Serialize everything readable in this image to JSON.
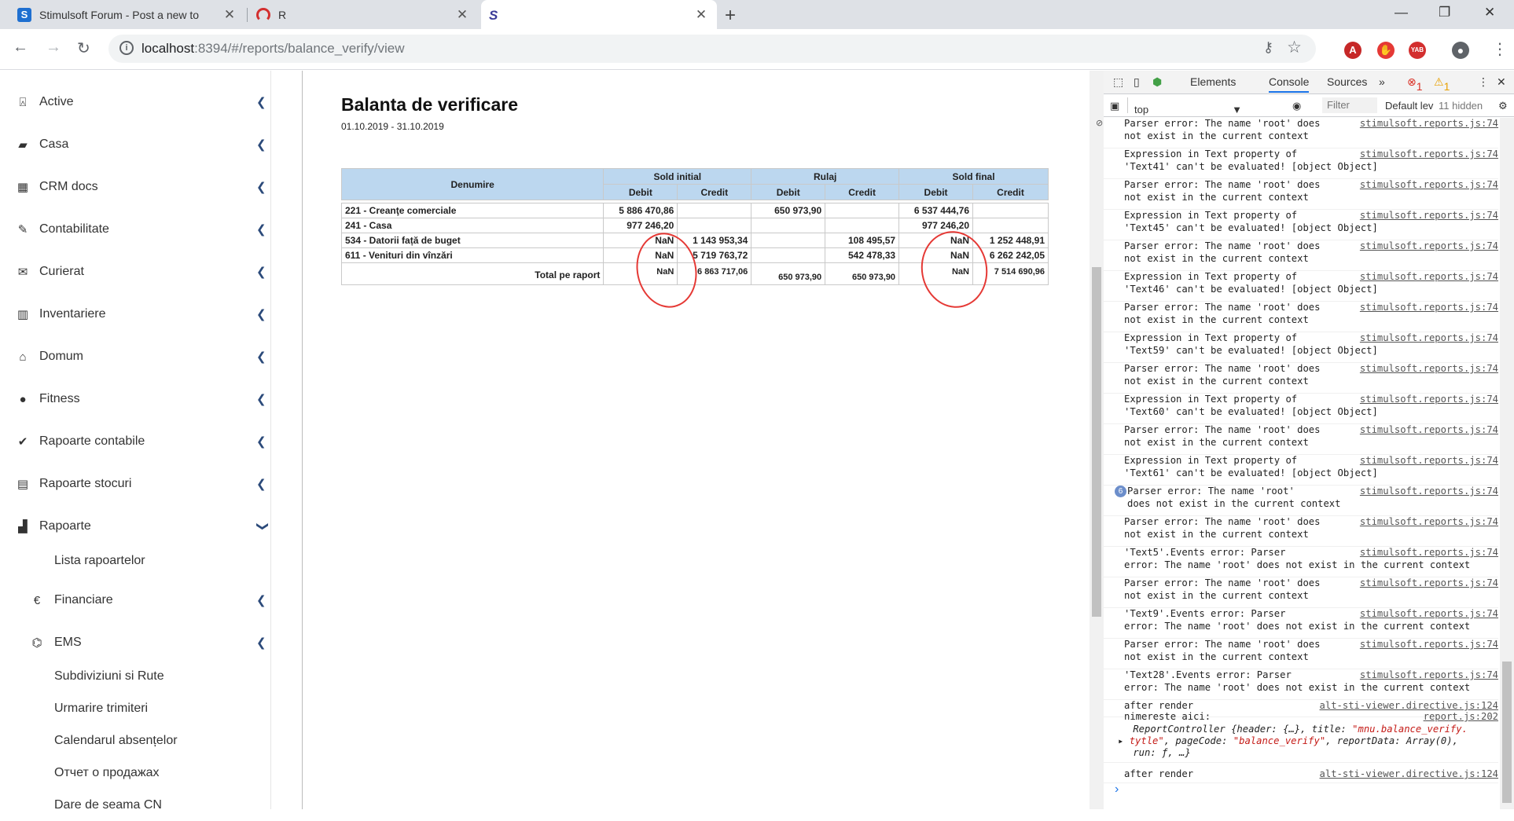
{
  "browser": {
    "tabs": [
      {
        "title": "Stimulsoft Forum - Post a new to",
        "favicon_color": "#1e6fd0"
      },
      {
        "title": "R",
        "favicon_color": "#d32f2f"
      },
      {
        "title": "",
        "favicon_color": "#3b3b98"
      }
    ],
    "new_tab": "+",
    "url_host": "localhost",
    "url_path": ":8394/#/reports/balance_verify/view",
    "ext_yab": "YAB"
  },
  "sidebar": {
    "items": [
      {
        "label": "Active",
        "icon": "bank-icon",
        "glyph": "⍓"
      },
      {
        "label": "Casa",
        "icon": "briefcase-icon",
        "glyph": "▰"
      },
      {
        "label": "CRM docs",
        "icon": "calendar-icon",
        "glyph": "▦"
      },
      {
        "label": "Contabilitate",
        "icon": "pin-icon",
        "glyph": "✎"
      },
      {
        "label": "Curierat",
        "icon": "envelope-icon",
        "glyph": "✉"
      },
      {
        "label": "Inventariere",
        "icon": "barcode-icon",
        "glyph": "▥"
      },
      {
        "label": "Domum",
        "icon": "home-icon",
        "glyph": "⌂"
      },
      {
        "label": "Fitness",
        "icon": "apple-icon",
        "glyph": "●"
      },
      {
        "label": "Rapoarte contabile",
        "icon": "checklist-icon",
        "glyph": "✔"
      },
      {
        "label": "Rapoarte stocuri",
        "icon": "stack-icon",
        "glyph": "▤"
      },
      {
        "label": "Rapoarte",
        "icon": "report-icon",
        "glyph": "▟"
      }
    ],
    "sub": {
      "lista": "Lista rapoartelor",
      "financiare": "Financiare",
      "financiare_glyph": "€",
      "ems": "EMS",
      "ems_glyph": "⌬",
      "leaves": [
        "Subdiviziuni si Rute",
        "Urmarire trimiteri",
        "Calendarul absențelor",
        "Отчет о продажах",
        "Dare de seama CN"
      ]
    }
  },
  "report": {
    "title": "Balanta de verificare",
    "period": "01.10.2019 - 31.10.2019",
    "header": {
      "denumire": "Denumire",
      "sold_initial": "Sold initial",
      "rulaj": "Rulaj",
      "sold_final": "Sold final",
      "debit": "Debit",
      "credit": "Credit"
    },
    "rows": [
      {
        "name": "221 - Creanţe comerciale",
        "si_debit": "5 886 470,86",
        "si_credit": "",
        "r_debit": "650 973,90",
        "r_credit": "",
        "sf_debit": "6 537 444,76",
        "sf_credit": ""
      },
      {
        "name": "241 - Casa",
        "si_debit": "977 246,20",
        "si_credit": "",
        "r_debit": "",
        "r_credit": "",
        "sf_debit": "977 246,20",
        "sf_credit": ""
      },
      {
        "name": "534 - Datorii față de buget",
        "si_debit": "NaN",
        "si_credit": "1 143 953,34",
        "r_debit": "",
        "r_credit": "108 495,57",
        "sf_debit": "NaN",
        "sf_credit": "1 252 448,91"
      },
      {
        "name": "611 - Venituri din vînzări",
        "si_debit": "NaN",
        "si_credit": "5 719 763,72",
        "r_debit": "",
        "r_credit": "542 478,33",
        "sf_debit": "NaN",
        "sf_credit": "6 262 242,05"
      }
    ],
    "total": {
      "label": "Total pe raport",
      "si_debit": "NaN",
      "si_credit": "6 863 717,06",
      "r_debit": "650 973,90",
      "r_credit": "650 973,90",
      "sf_debit": "NaN",
      "sf_credit": "7 514 690,96"
    },
    "annotation_color": "#e53935"
  },
  "devtools": {
    "tabs": {
      "elements": "Elements",
      "console": "Console",
      "sources": "Sources",
      "more": "»",
      "errors": "1",
      "warnings": "1"
    },
    "context": "top",
    "filter_placeholder": "Filter",
    "levels": "Default lev",
    "hidden": "11 hidden",
    "logs": [
      {
        "msg": "Parser error: The name 'root' does\nnot exist in the current context",
        "src": "stimulsoft.reports.js:74"
      },
      {
        "msg": "Expression in Text property of\n'Text41' can't be evaluated! [object Object]",
        "src": "stimulsoft.reports.js:74"
      },
      {
        "msg": "Parser error: The name 'root' does\nnot exist in the current context",
        "src": "stimulsoft.reports.js:74"
      },
      {
        "msg": "Expression in Text property of\n'Text45' can't be evaluated! [object Object]",
        "src": "stimulsoft.reports.js:74"
      },
      {
        "msg": "Parser error: The name 'root' does\nnot exist in the current context",
        "src": "stimulsoft.reports.js:74"
      },
      {
        "msg": "Expression in Text property of\n'Text46' can't be evaluated! [object Object]",
        "src": "stimulsoft.reports.js:74"
      },
      {
        "msg": "Parser error: The name 'root' does\nnot exist in the current context",
        "src": "stimulsoft.reports.js:74"
      },
      {
        "msg": "Expression in Text property of\n'Text59' can't be evaluated! [object Object]",
        "src": "stimulsoft.reports.js:74"
      },
      {
        "msg": "Parser error: The name 'root' does\nnot exist in the current context",
        "src": "stimulsoft.reports.js:74"
      },
      {
        "msg": "Expression in Text property of\n'Text60' can't be evaluated! [object Object]",
        "src": "stimulsoft.reports.js:74"
      },
      {
        "msg": "Parser error: The name 'root' does\nnot exist in the current context",
        "src": "stimulsoft.reports.js:74"
      },
      {
        "msg": "Expression in Text property of\n'Text61' can't be evaluated! [object Object]",
        "src": "stimulsoft.reports.js:74"
      },
      {
        "msg": "Parser error: The name 'root'\ndoes not exist in the current context",
        "src": "stimulsoft.reports.js:74",
        "badge": "6"
      },
      {
        "msg": "Parser error: The name 'root' does\nnot exist in the current context",
        "src": "stimulsoft.reports.js:74"
      },
      {
        "msg": "'Text5'.Events error: Parser\nerror: The name 'root' does not exist in the current context",
        "src": "stimulsoft.reports.js:74"
      },
      {
        "msg": "Parser error: The name 'root' does\nnot exist in the current context",
        "src": "stimulsoft.reports.js:74"
      },
      {
        "msg": "'Text9'.Events error: Parser\nerror: The name 'root' does not exist in the current context",
        "src": "stimulsoft.reports.js:74"
      },
      {
        "msg": "Parser error: The name 'root' does\nnot exist in the current context",
        "src": "stimulsoft.reports.js:74"
      },
      {
        "msg": "'Text28'.Events error: Parser\nerror: The name 'root' does not exist in the current context",
        "src": "stimulsoft.reports.js:74"
      },
      {
        "msg": "after render",
        "src": "alt-sti-viewer.directive.js:124"
      }
    ],
    "nimereste": {
      "msg": "nimereste aici:",
      "src": "report.js:202",
      "obj1": " ReportController {header: {…}, title: ",
      "obj1_str": "\"mnu.balance_verify.",
      "obj2_str": "tytle\"",
      "obj2_rest": ", pageCode: ",
      "obj2_str2": "\"balance_verify\"",
      "obj2_rest2": ", reportData: Array(0),",
      "obj3": " run: ƒ, …}"
    },
    "last": {
      "msg": "after render",
      "src": "alt-sti-viewer.directive.js:124"
    },
    "prompt": "›"
  }
}
